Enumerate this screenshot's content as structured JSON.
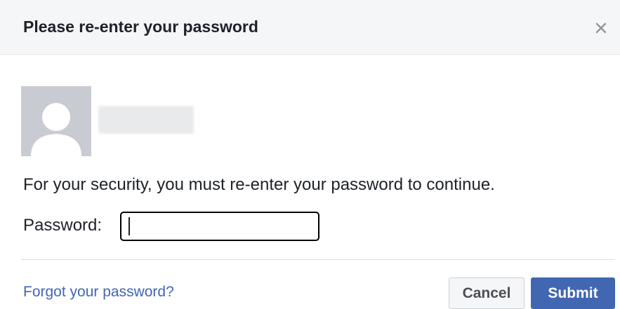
{
  "dialog": {
    "title": "Please re-enter your password",
    "close_icon": "close-icon"
  },
  "user": {
    "avatar_icon": "default-avatar-icon"
  },
  "body": {
    "message": "For your security, you must re-enter your password to continue.",
    "password_label": "Password:",
    "password_value": ""
  },
  "footer": {
    "forgot_link": "Forgot your password?",
    "cancel_label": "Cancel",
    "submit_label": "Submit"
  },
  "colors": {
    "header_bg": "#f5f6f7",
    "link": "#4267b2",
    "submit_bg": "#4267b2",
    "avatar_bg": "#c8ccd2"
  }
}
